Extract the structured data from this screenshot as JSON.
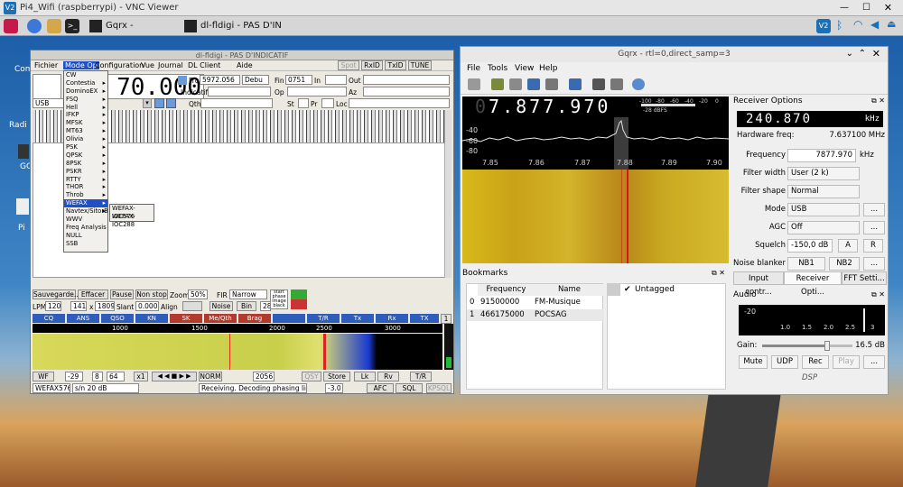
{
  "vnc": {
    "title": "Pi4_Wifi (raspberrypi) - VNC Viewer",
    "icon_text": "V2"
  },
  "taskbar": {
    "task1": "Gqrx - rtl=0,direct_sa...",
    "task2": "dl-fldigi - PAS D'INDICAT..."
  },
  "desktop": {
    "icon1": "Com",
    "icon2": "Radi",
    "icon3": "GC",
    "icon4": "Pi"
  },
  "fldigi": {
    "title": "dl-fldigi - PAS D'INDICATIF",
    "menu": [
      "Fichier",
      "Mode Op",
      "Configuration",
      "Vue",
      "Journal",
      "DL Client",
      "Aide"
    ],
    "top_buttons": [
      "Spot",
      "RxID",
      "TxID",
      "TUNE"
    ],
    "freq_display": "70.000",
    "frq_label": "Frq",
    "frq_value": "5972.056",
    "debut_label": "Debu",
    "fin_label": "Fin",
    "fin_value": "0751",
    "in_label": "In",
    "out_label": "Out",
    "op_label": "Op",
    "az_label": "Az",
    "indicatif_label": "Indicatif",
    "qth_label": "Qth",
    "st_label": "St",
    "pr_label": "Pr",
    "loc_label": "Loc",
    "mode_combo": "USB",
    "mode_menu": [
      {
        "label": "CW",
        "arrow": false
      },
      {
        "label": "Contestia",
        "arrow": true
      },
      {
        "label": "DominoEX",
        "arrow": true
      },
      {
        "label": "FSQ",
        "arrow": true
      },
      {
        "label": "Hell",
        "arrow": true
      },
      {
        "label": "IFKP",
        "arrow": true
      },
      {
        "label": "MFSK",
        "arrow": true
      },
      {
        "label": "MT63",
        "arrow": true
      },
      {
        "label": "Olivia",
        "arrow": true
      },
      {
        "label": "PSK",
        "arrow": true
      },
      {
        "label": "QPSK",
        "arrow": true
      },
      {
        "label": "8PSK",
        "arrow": true
      },
      {
        "label": "PSKR",
        "arrow": true
      },
      {
        "label": "RTTY",
        "arrow": true
      },
      {
        "label": "THOR",
        "arrow": true
      },
      {
        "label": "Throb",
        "arrow": true
      },
      {
        "label": "WEFAX",
        "arrow": true,
        "selected": true
      },
      {
        "label": "Navtex/SitorB",
        "arrow": true
      },
      {
        "label": "WWV",
        "arrow": false
      },
      {
        "label": "Freq Analysis",
        "arrow": false
      },
      {
        "label": "NULL",
        "arrow": false
      },
      {
        "label": "SSB",
        "arrow": false
      }
    ],
    "wefax_submenu": [
      "WEFAX-IOC576",
      "WEFAX-IOC288"
    ],
    "row1": {
      "save": "Sauvegarde...",
      "clear": "Effacer",
      "pause": "Pause",
      "nonstop": "Non stop",
      "zoom_label": "Zoom",
      "zoom": "50%",
      "fir_label": "FIR",
      "fir": "Narrow"
    },
    "row2": {
      "lpm_label": "LPM",
      "lpm": "120",
      "v141": "141",
      "x_label": "x",
      "v1809": "1809",
      "slant_label": "Slant",
      "slant": "0.000",
      "align_label": "Align",
      "noise": "Noise",
      "bin": "Bin",
      "v28": "28"
    },
    "start_image": "start phase image black stop",
    "macros": [
      "CQ",
      "ANS",
      "QSO",
      "KN",
      "SK",
      "Me/Qth",
      "Brag",
      "",
      "T/R",
      "Tx",
      "Rx",
      "TX"
    ],
    "macro_page": "1",
    "ruler": [
      "1000",
      "1500",
      "2000",
      "2500",
      "3000"
    ],
    "bottom": {
      "wf": "WF",
      "v29": "-29",
      "v8": "8",
      "v64": "64",
      "x1": "x1",
      "norm": "NORM",
      "v2056": "2056",
      "qsy": "QSY",
      "store": "Store",
      "lk": "Lk",
      "rv": "Rv",
      "tr": "T/R"
    },
    "status": {
      "mode": "WEFAX576",
      "sn": "s/n  20 dB",
      "message": "Receiving. Decoding phasing line, res",
      "level": "-3.0",
      "afc": "AFC",
      "sql": "SQL",
      "kpsql": "KPSQL"
    }
  },
  "gqrx": {
    "title": "Gqrx - rtl=0,direct_samp=3",
    "menu": [
      "File",
      "Tools",
      "View",
      "Help"
    ],
    "freq": "7.877.970",
    "freq_faint": "0",
    "db_scale": [
      "-100",
      "-80",
      "-60",
      "-40",
      "-20",
      "0"
    ],
    "db_reading": "-28 dBFS",
    "plot_db": [
      "-40",
      "-60",
      "-80"
    ],
    "freq_axis": [
      "7.85",
      "7.86",
      "7.87",
      "7.88",
      "7.89",
      "7.90"
    ],
    "bookmarks_title": "Bookmarks",
    "bm_headers": {
      "freq": "Frequency",
      "name": "Name"
    },
    "bookmarks": [
      {
        "idx": "0",
        "freq": "91500000",
        "name": "FM-Musique"
      },
      {
        "idx": "1",
        "freq": "466175000",
        "name": "POCSAG"
      }
    ],
    "tag": "Untagged",
    "ro_title": "Receiver Options",
    "hw_freq_big": "240.870",
    "hw_unit": "kHz",
    "hw_label": "Hardware freq:",
    "hw_value": "7.637100 MHz",
    "freq_label": "Frequency",
    "freq_value": "7877.970",
    "freq_unit": "kHz",
    "filter_width_label": "Filter width",
    "filter_width": "User (2 k)",
    "filter_shape_label": "Filter shape",
    "filter_shape": "Normal",
    "mode_label": "Mode",
    "mode": "USB",
    "agc_label": "AGC",
    "agc": "Off",
    "squelch_label": "Squelch",
    "squelch": "-150,0 dB",
    "btn_a": "A",
    "btn_r": "R",
    "ellipsis": "...",
    "nb_label": "Noise blanker",
    "nb1": "NB1",
    "nb2": "NB2",
    "tabs": [
      "Input contr...",
      "Receiver Opti...",
      "FFT Setti..."
    ],
    "audio_title": "Audio",
    "audio_scale": [
      "-20",
      "1.0",
      "1.5",
      "2.0",
      "2.5",
      "3"
    ],
    "gain_label": "Gain:",
    "gain_value": "16.5 dB",
    "gain_level": 0.72,
    "audio_btns": [
      "Mute",
      "UDP",
      "Rec",
      "Play",
      "..."
    ],
    "dsp": "DSP"
  }
}
